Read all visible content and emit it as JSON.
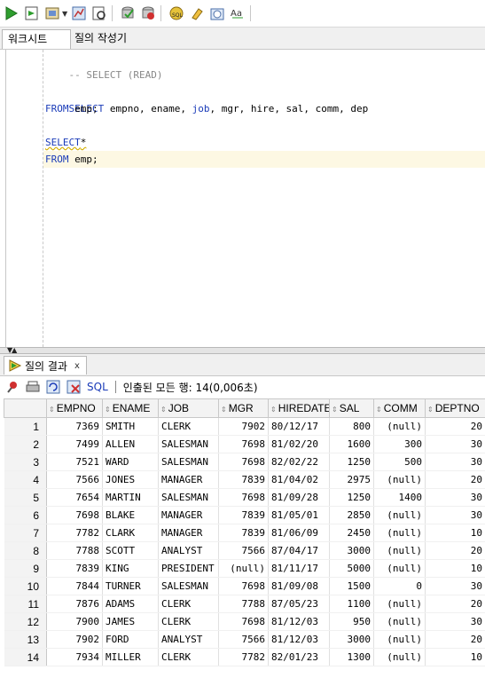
{
  "toolbar": {
    "icons": [
      "run-statement-icon",
      "run-script-icon",
      "commit-icon",
      "autotrace-icon",
      "explain-plan-icon",
      "sql-tuning-icon",
      "commit-check-icon",
      "rollback-icon",
      "unshared-sql-icon",
      "eraser-icon",
      "history-icon",
      "format-icon"
    ],
    "colors": {
      "run": "#2e9e2e",
      "accent": "#1a3bb8"
    }
  },
  "editor_tabs": [
    {
      "label": "워크시트",
      "active": true
    },
    {
      "label": "질의 작성기",
      "active": false
    }
  ],
  "editor": {
    "lines": [
      {
        "text": "-- SELECT (READ)"
      },
      {
        "text": ""
      },
      {
        "text": "SELECT empno, ename, job, mgr, hire, sal, comm, dep"
      },
      {
        "text": "FROM emp;"
      },
      {
        "text": ""
      },
      {
        "text": "SELECT*"
      },
      {
        "text": "FROM emp;"
      }
    ],
    "highlight_color": "#fdf8e3"
  },
  "results": {
    "tab_label": "질의 결과",
    "tab_close": "x",
    "sql_label": "SQL",
    "status": "인출된 모든 행: 14(0,006초)",
    "columns": [
      "EMPNO",
      "ENAME",
      "JOB",
      "MGR",
      "HIREDATE",
      "SAL",
      "COMM",
      "DEPTNO"
    ],
    "rows": [
      [
        "1",
        "7369",
        "SMITH",
        "CLERK",
        "7902",
        "80/12/17",
        "800",
        "(null)",
        "20"
      ],
      [
        "2",
        "7499",
        "ALLEN",
        "SALESMAN",
        "7698",
        "81/02/20",
        "1600",
        "300",
        "30"
      ],
      [
        "3",
        "7521",
        "WARD",
        "SALESMAN",
        "7698",
        "82/02/22",
        "1250",
        "500",
        "30"
      ],
      [
        "4",
        "7566",
        "JONES",
        "MANAGER",
        "7839",
        "81/04/02",
        "2975",
        "(null)",
        "20"
      ],
      [
        "5",
        "7654",
        "MARTIN",
        "SALESMAN",
        "7698",
        "81/09/28",
        "1250",
        "1400",
        "30"
      ],
      [
        "6",
        "7698",
        "BLAKE",
        "MANAGER",
        "7839",
        "81/05/01",
        "2850",
        "(null)",
        "30"
      ],
      [
        "7",
        "7782",
        "CLARK",
        "MANAGER",
        "7839",
        "81/06/09",
        "2450",
        "(null)",
        "10"
      ],
      [
        "8",
        "7788",
        "SCOTT",
        "ANALYST",
        "7566",
        "87/04/17",
        "3000",
        "(null)",
        "20"
      ],
      [
        "9",
        "7839",
        "KING",
        "PRESIDENT",
        "(null)",
        "81/11/17",
        "5000",
        "(null)",
        "10"
      ],
      [
        "10",
        "7844",
        "TURNER",
        "SALESMAN",
        "7698",
        "81/09/08",
        "1500",
        "0",
        "30"
      ],
      [
        "11",
        "7876",
        "ADAMS",
        "CLERK",
        "7788",
        "87/05/23",
        "1100",
        "(null)",
        "20"
      ],
      [
        "12",
        "7900",
        "JAMES",
        "CLERK",
        "7698",
        "81/12/03",
        "950",
        "(null)",
        "30"
      ],
      [
        "13",
        "7902",
        "FORD",
        "ANALYST",
        "7566",
        "81/12/03",
        "3000",
        "(null)",
        "20"
      ],
      [
        "14",
        "7934",
        "MILLER",
        "CLERK",
        "7782",
        "82/01/23",
        "1300",
        "(null)",
        "10"
      ]
    ]
  }
}
